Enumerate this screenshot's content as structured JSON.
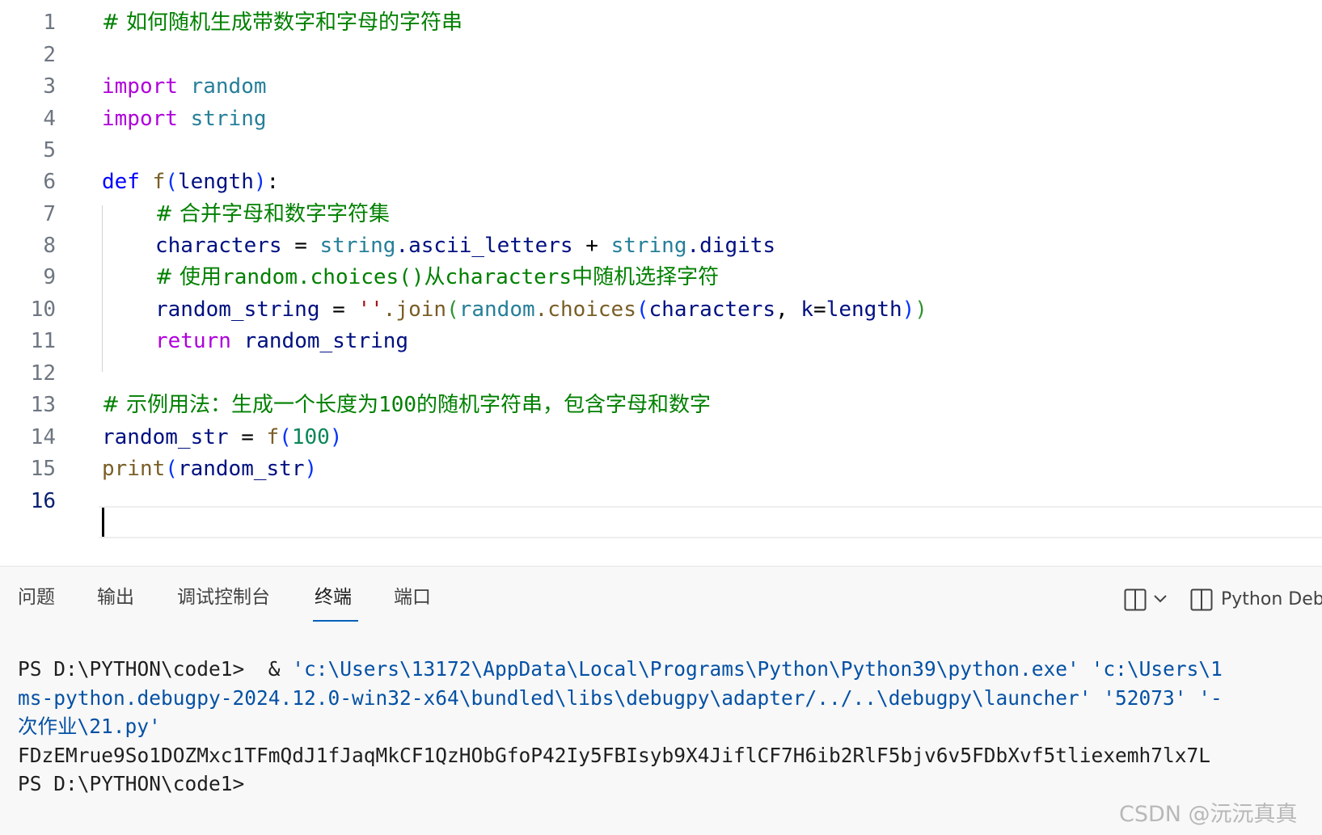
{
  "editor": {
    "lines": [
      {
        "number": "1",
        "comment": "# 如何随机生成带数字和字母的字符串"
      },
      {
        "number": "2"
      },
      {
        "number": "3",
        "keyword": "import",
        "module": "random"
      },
      {
        "number": "4",
        "keyword": "import",
        "module": "string"
      },
      {
        "number": "5"
      },
      {
        "number": "6",
        "keyword": "def",
        "func": "f",
        "open": "(",
        "param": "length",
        "close": ")",
        "colon": ":"
      },
      {
        "number": "7",
        "comment": "# 合并字母和数字字符集"
      },
      {
        "number": "8",
        "var": "characters",
        "eq": " = ",
        "mod1": "string",
        "attr1": ".ascii_letters",
        "plus": " + ",
        "mod2": "string",
        "attr2": ".digits"
      },
      {
        "number": "9",
        "comment_a": "# 使用",
        "comment_b": "random.choices()",
        "comment_c": "从",
        "comment_d": "characters",
        "comment_e": "中随机选择字符"
      },
      {
        "number": "10",
        "var": "random_string",
        "eq": " = ",
        "str": "''",
        "join": ".join",
        "open1": "(",
        "mod": "random",
        "choices": ".choices",
        "open2": "(",
        "arg1": "characters",
        "comma": ", ",
        "kw": "k",
        "kweq": "=",
        "arg2": "length",
        "close2": ")",
        "close1": ")"
      },
      {
        "number": "11",
        "keyword": "return",
        "var": "random_string"
      },
      {
        "number": "12"
      },
      {
        "number": "13",
        "comment_a": "# 示例用法：生成一个长度为",
        "comment_b": "100",
        "comment_c": "的随机字符串，包含字母和数字"
      },
      {
        "number": "14",
        "var": "random_str",
        "eq": " = ",
        "func": "f",
        "open": "(",
        "num": "100",
        "close": ")"
      },
      {
        "number": "15",
        "func": "print",
        "open": "(",
        "var": "random_str",
        "close": ")"
      },
      {
        "number": "16"
      }
    ]
  },
  "panel": {
    "tabs": [
      {
        "label": "问题"
      },
      {
        "label": "输出"
      },
      {
        "label": "调试控制台"
      },
      {
        "label": "终端",
        "active": true
      },
      {
        "label": "端口"
      }
    ],
    "session_label": "Python Deb",
    "accent_color": "#005fb8"
  },
  "terminal": {
    "line1_prompt": "PS D:\\PYTHON\\code1>",
    "line1_amp": "  & ",
    "line1_path1": "'c:\\Users\\13172\\AppData\\Local\\Programs\\Python\\Python39\\python.exe'",
    "line1_gap": " ",
    "line1_path2": "'c:\\Users\\1",
    "line2_text": "ms-python.debugpy-2024.12.0-win32-x64\\bundled\\libs\\debugpy\\adapter/../..\\debugpy\\launcher' '52073' '-",
    "line3_cjk": "次作业",
    "line3_rest": "\\21.py'",
    "line4_output": "FDzEMrue9So1DOZMxc1TFmQdJ1fJaqMkCF1QzHObGfoP42Iy5FBIsyb9X4JiflCF7H6ib2RlF5bjv6v5FDbXvf5tliexemh7lx7L",
    "line5_prompt": "PS D:\\PYTHON\\code1>"
  },
  "watermark": "CSDN @沅沅真真"
}
